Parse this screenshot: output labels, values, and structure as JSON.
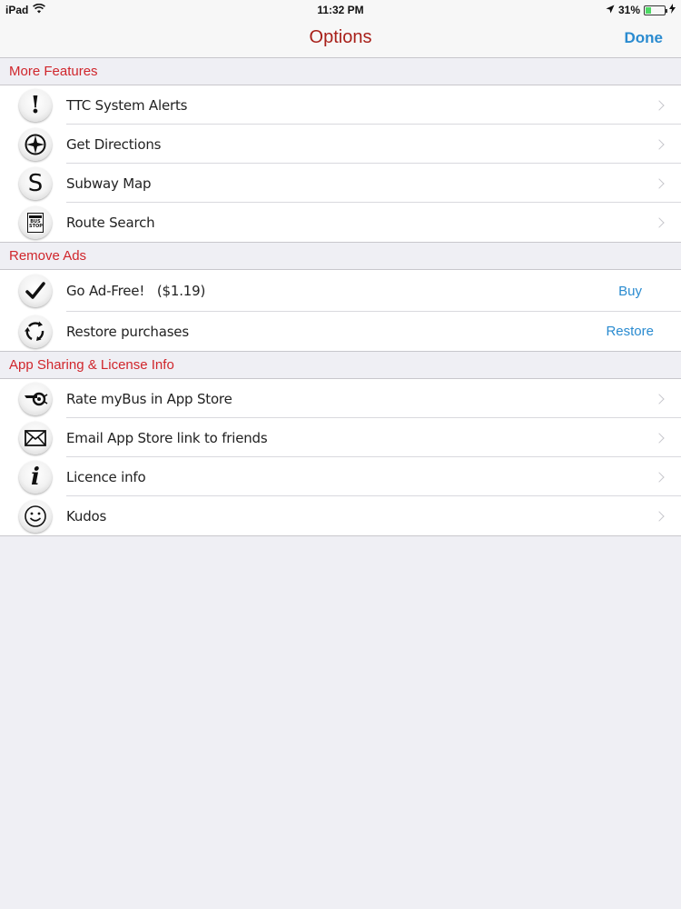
{
  "status_bar": {
    "device": "iPad",
    "time": "11:32 PM",
    "battery": "31%",
    "battery_level": 0.31
  },
  "nav": {
    "title": "Options",
    "done_label": "Done"
  },
  "sections": [
    {
      "header": "More Features",
      "rows": [
        {
          "label": "TTC System Alerts",
          "icon": "exclamation-icon"
        },
        {
          "label": "Get Directions",
          "icon": "compass-icon"
        },
        {
          "label": "Subway Map",
          "icon": "subway-s-icon"
        },
        {
          "label": "Route Search",
          "icon": "bus-stop-icon",
          "icon_text": "BUS STOP"
        }
      ]
    },
    {
      "header": "Remove Ads",
      "rows": [
        {
          "label": "Go Ad-Free!   ($1.19)",
          "icon": "checkmark-icon",
          "action": "Buy"
        },
        {
          "label": "Restore purchases",
          "icon": "restore-arrows-icon",
          "action": "Restore"
        }
      ]
    },
    {
      "header": "App Sharing & License Info",
      "rows": [
        {
          "label": "Rate myBus in App Store",
          "icon": "whistle-icon"
        },
        {
          "label": "Email App Store link to friends",
          "icon": "envelope-icon"
        },
        {
          "label": "Licence info",
          "icon": "info-icon"
        },
        {
          "label": "Kudos",
          "icon": "smiley-icon"
        }
      ]
    }
  ],
  "colors": {
    "accent_red": "#d0262c",
    "title_red": "#a8201a",
    "link_blue": "#2a8bd0",
    "background": "#efeff4"
  }
}
